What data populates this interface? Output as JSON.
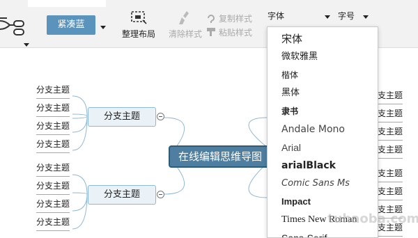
{
  "toolbar": {
    "theme_label": "紧凑蓝",
    "layout_label": "整理布局",
    "clear_style_label": "清除样式",
    "copy_style_label": "复制样式",
    "paste_style_label": "粘贴样式",
    "font_label": "字体",
    "size_label": "字号",
    "icons": {
      "structure": "mindmap-structure-icon",
      "layout": "arrange-layout-icon",
      "clear": "brush-icon",
      "copy": "copy-style-icon",
      "paste": "paste-style-icon"
    }
  },
  "mindmap": {
    "central_topic": "在线编辑思维导图",
    "branches": [
      {
        "label": "分支主题",
        "leaves": [
          "分支主题",
          "分支主题",
          "分支主题",
          "分支主题"
        ]
      },
      {
        "label": "分支主题",
        "leaves": [
          "分支主题",
          "分支主题",
          "分支主题",
          "分支主题"
        ]
      }
    ],
    "right_leaves": [
      "分支主题",
      "分支主题",
      "分支主题",
      "分支主题",
      "分支主题",
      "分支主题",
      "分支主题",
      "分支主题"
    ]
  },
  "font_dropdown": {
    "items": [
      "宋体",
      "微软雅黑",
      "楷体",
      "黑体",
      "隶书",
      "Andale Mono",
      "Arial",
      "arialBlack",
      "Comic Sans Ms",
      "Impact",
      "Times New Roman",
      "Sans-Serif"
    ]
  },
  "colors": {
    "accent": "#5a93bb",
    "central_bg": "#4e7fa1",
    "branch_bg": "#eaf2f8",
    "link": "#8fb8d2"
  },
  "watermark": "tuhaoba.com"
}
